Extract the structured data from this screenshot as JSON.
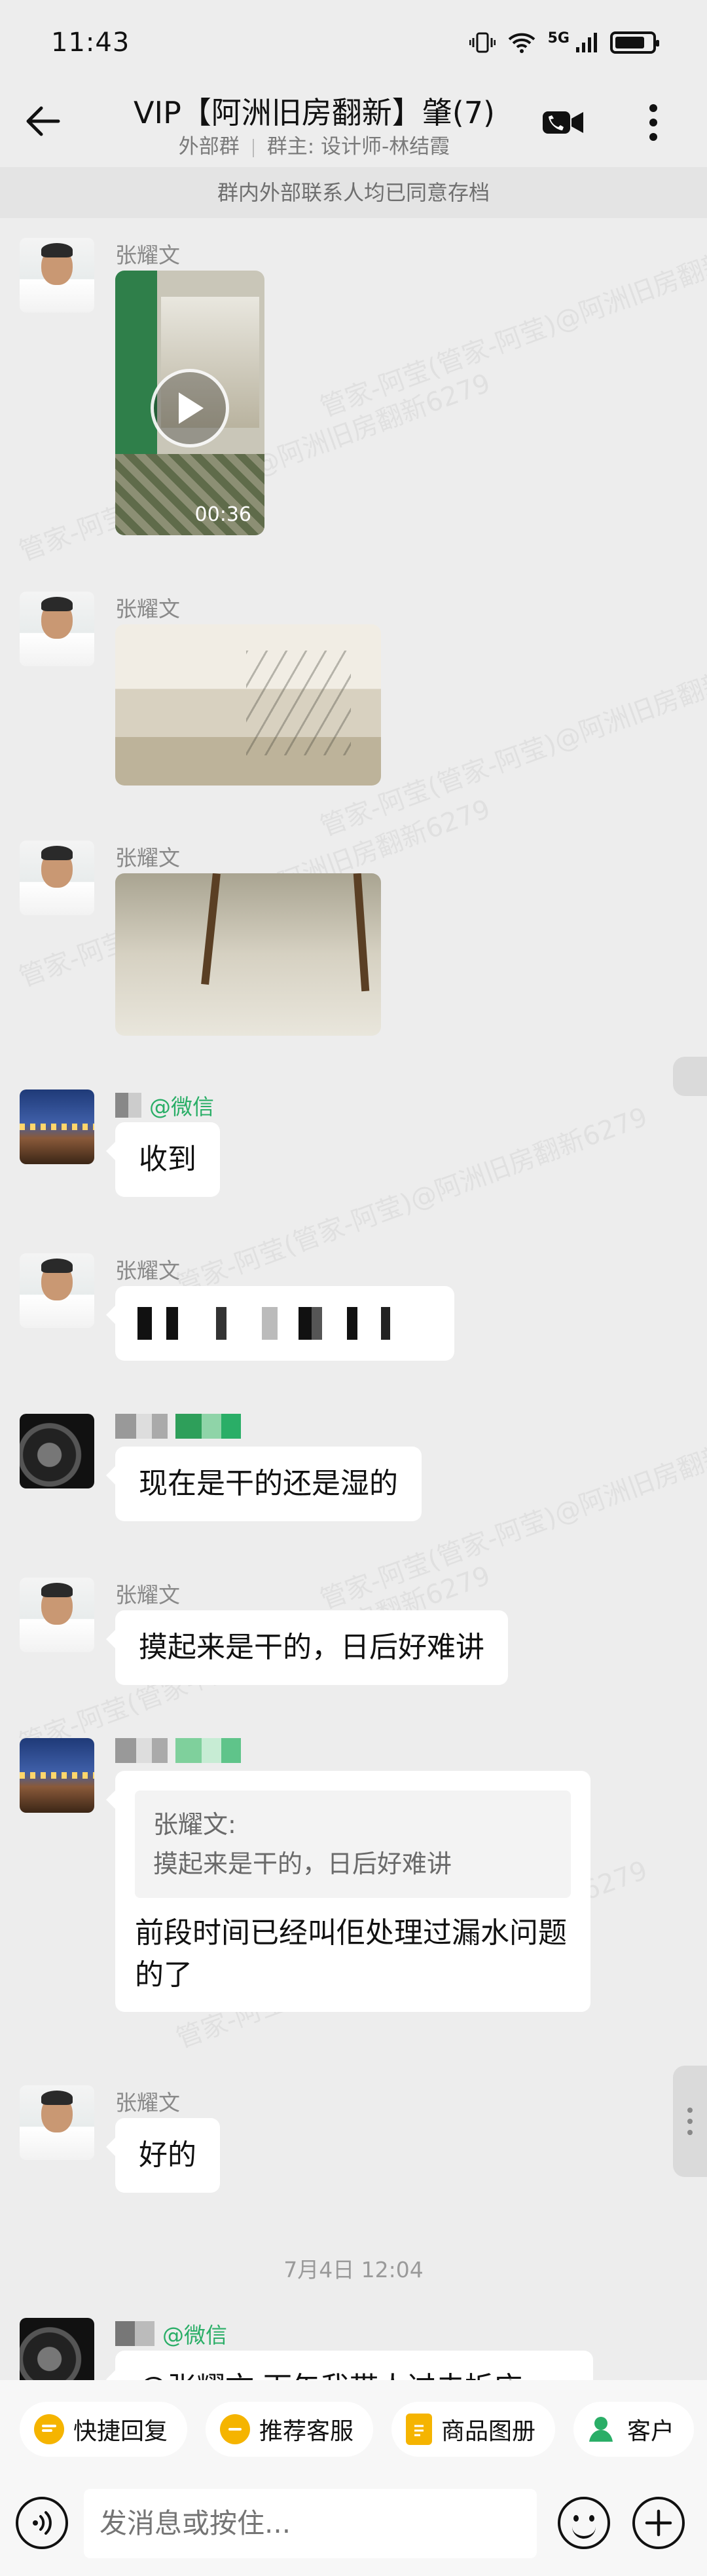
{
  "status_bar": {
    "time": "11:43",
    "network": "5G"
  },
  "header": {
    "title": "VIP【阿洲旧房翻新】肇(7)",
    "group_type": "外部群",
    "group_owner": "群主: 设计师-林结霞"
  },
  "notice": "群内外部联系人均已同意存档",
  "watermark": "管家-阿莹(管家-阿莹)@阿洲旧房翻新6279",
  "messages": [
    {
      "sender": "张耀文",
      "kind": "video",
      "duration": "00:36"
    },
    {
      "sender": "张耀文",
      "kind": "image"
    },
    {
      "sender": "张耀文",
      "kind": "image"
    },
    {
      "sender_tag": "@微信",
      "kind": "text",
      "text": "收到"
    },
    {
      "sender": "张耀文",
      "kind": "pixelated"
    },
    {
      "kind": "text",
      "text": "现在是干的还是湿的"
    },
    {
      "sender": "张耀文",
      "kind": "text",
      "text": "摸起来是干的，日后好难讲"
    },
    {
      "kind": "quote",
      "quote_author": "张耀文:",
      "quote_text": "摸起来是干的，日后好难讲",
      "text": "前段时间已经叫佢处理过漏水问题的了"
    },
    {
      "sender": "张耀文",
      "kind": "text",
      "text": "好的"
    },
    {
      "kind": "timestamp",
      "text": "7月4日  12:04"
    },
    {
      "sender_tag": "@微信",
      "kind": "text",
      "text": "@张耀文 下午我带人过去拆床"
    }
  ],
  "quick_actions": [
    {
      "label": "快捷回复",
      "icon": "quick-reply-icon"
    },
    {
      "label": "推荐客服",
      "icon": "service-icon"
    },
    {
      "label": "商品图册",
      "icon": "catalog-icon"
    },
    {
      "label": "客户",
      "icon": "customer-icon"
    }
  ],
  "input": {
    "placeholder": "发消息或按住..."
  },
  "colors": {
    "background": "#ededed",
    "wechat_green": "#2aae67",
    "bubble": "#ffffff"
  }
}
